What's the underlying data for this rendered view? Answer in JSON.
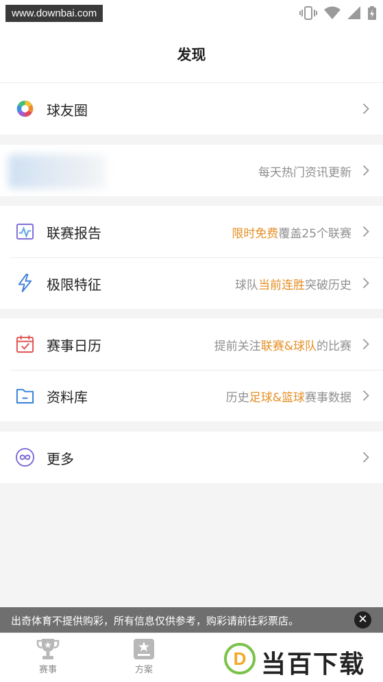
{
  "watermark": "www.downbai.com",
  "header": {
    "title": "发现"
  },
  "group1": [
    {
      "label": "球友圈"
    }
  ],
  "group2": {
    "desc": "每天热门资讯更新"
  },
  "group3": [
    {
      "label": "联赛报告",
      "desc_hl": "限时免费",
      "desc_rest": "覆盖25个联赛"
    },
    {
      "label": "极限特征",
      "desc_pre": "球队",
      "desc_hl": "当前连胜",
      "desc_post": "突破历史"
    }
  ],
  "group4": [
    {
      "label": "赛事日历",
      "desc_pre": "提前关注",
      "desc_hl": "联赛&球队",
      "desc_post": "的比赛"
    },
    {
      "label": "资料库",
      "desc_pre": "历史",
      "desc_hl": "足球&篮球",
      "desc_post": "赛事数据"
    }
  ],
  "group5": [
    {
      "label": "更多"
    }
  ],
  "notice": {
    "text": "出奇体育不提供购彩，所有信息仅供参考，购彩请前往彩票店。",
    "close": "✕"
  },
  "tabs": [
    {
      "label": "赛事",
      "icon": "trophy-icon"
    },
    {
      "label": "方案",
      "icon": "star-doc-icon"
    }
  ],
  "brand": {
    "logo_letter": "D",
    "text": "当百下载"
  },
  "colors": {
    "highlight": "#e58f24",
    "accent_purple": "#7b6cd6",
    "calendar_red": "#e05050",
    "folder_blue": "#2f7fd8"
  }
}
